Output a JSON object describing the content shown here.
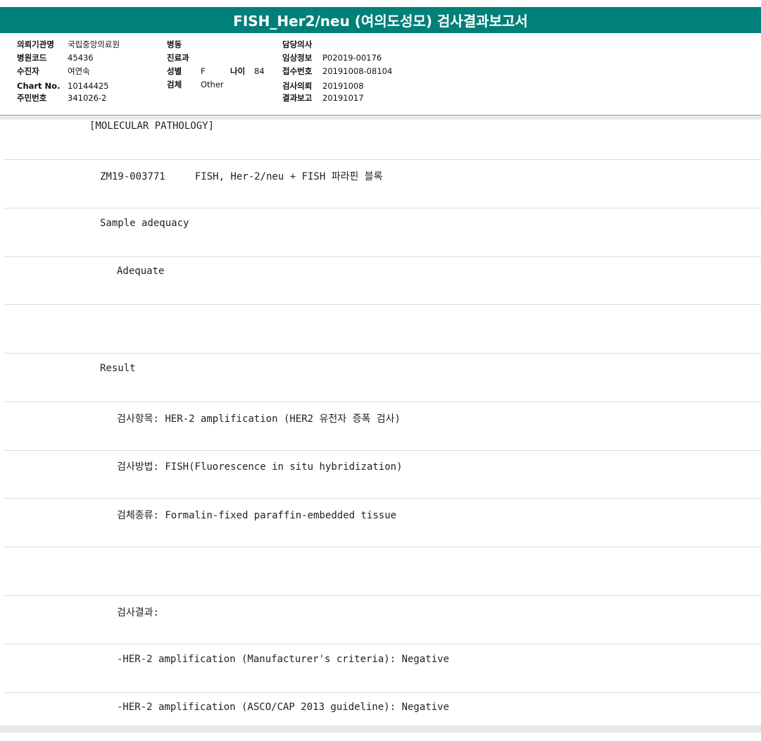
{
  "title": "FISH_Her2/neu (여의도성모) 검사결과보고서",
  "info": {
    "col1": [
      {
        "label": "의뢰기관명",
        "value": "국립중앙의료원"
      },
      {
        "label": "병원코드",
        "value": "45436"
      },
      {
        "label": "수진자",
        "value": "여연숙"
      },
      {
        "label": "Chart No.",
        "value": "10144425"
      },
      {
        "label": "주민번호",
        "value": "341026-2"
      }
    ],
    "col2": [
      {
        "label": "병동",
        "value": ""
      },
      {
        "label": "진료과",
        "value": ""
      },
      {
        "label": "성별",
        "value": "F"
      },
      {
        "label": "검체",
        "value": "Other"
      }
    ],
    "age_label": "나이",
    "age_value": "84",
    "col3": [
      {
        "label": "담당의사",
        "value": ""
      },
      {
        "label": "임상정보",
        "value": "P02019-00176"
      },
      {
        "label": "접수번호",
        "value": "20191008-08104"
      },
      {
        "label": "검사의뢰",
        "value": "20191008"
      },
      {
        "label": "결과보고",
        "value": "20191017"
      }
    ]
  },
  "report_lines": [
    "[MOLECULAR PATHOLOGY]",
    "ZM19-003771     FISH, Her-2/neu + FISH 파라핀 블록",
    "Sample adequacy",
    "Adequate",
    "",
    "Result",
    "검사항목: HER-2 amplification (HER2 유전자 증폭 검사)",
    "검사방법: FISH(Fluorescence in situ hybridization)",
    "검체종류: Formalin-fixed paraffin-embedded tissue",
    "",
    "검사결과:",
    "-HER-2 amplification (Manufacturer's criteria): Negative",
    "-HER-2 amplification (ASCO/CAP 2013 guideline): Negative"
  ]
}
